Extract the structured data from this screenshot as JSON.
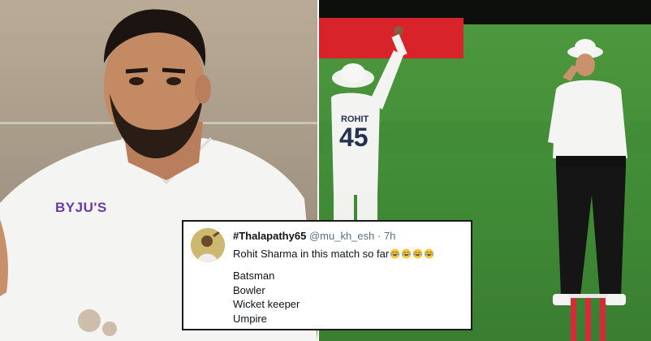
{
  "composite_title": "",
  "left_panel": {
    "jersey_sponsor": "BYJU'S"
  },
  "right_panel": {
    "player_jersey_name": "ROHIT",
    "player_jersey_number": "45"
  },
  "tweet": {
    "display_name": "#Thalapathy65",
    "handle": "@mu_kh_esh",
    "separator": "·",
    "time": "7h",
    "text": "Rohit Sharma in this match so far",
    "emoji_count": 4,
    "emoji_name": "face-with-tears-of-joy-icon",
    "list_items": [
      "Batsman",
      "Bowler",
      "Wicket keeper",
      "Umpire"
    ]
  },
  "colors": {
    "card_border": "#1a1a1a",
    "handle_gray": "#5b7083",
    "board_red": "#d9232b",
    "field_green": "#4a943c"
  }
}
